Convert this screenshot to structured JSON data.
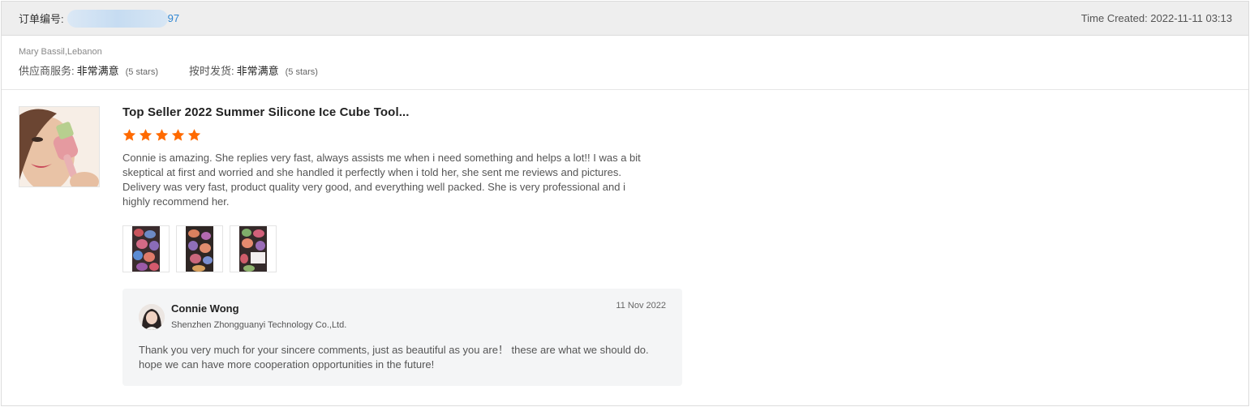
{
  "order": {
    "label": "订单编号:",
    "number_tail": "97"
  },
  "time_created": "Time Created: 2022-11-11 03:13",
  "buyer": {
    "name_location": "Mary Bassil,Lebanon",
    "ratings": [
      {
        "label": "供应商服务:",
        "value": "非常满意",
        "stars": "(5 stars)"
      },
      {
        "label": "按时发货:",
        "value": "非常满意",
        "stars": "(5 stars)"
      }
    ]
  },
  "product": {
    "title": "Top Seller 2022 Summer Silicone Ice Cube Tool...",
    "rating": 5,
    "star_color": "#ff6a00",
    "review": "Connie is amazing. She replies very fast, always assists me when i need something and helps a lot!! I was a bit skeptical at first and worried and she handled it perfectly when i told her, she sent me reviews and pictures. Delivery was very fast, product quality very good, and everything well packed. She is very professional and i highly recommend her.",
    "photo_count": 3
  },
  "reply": {
    "name": "Connie Wong",
    "company": "Shenzhen Zhongguanyi Technology Co.,Ltd.",
    "date": "11 Nov 2022",
    "text": "Thank you very much for your sincere comments, just as beautiful as you are！  these are what we should do. hope we can have more cooperation opportunities in the future!"
  },
  "colors": {
    "link": "#2f86d3",
    "header_bg": "#eeeeee",
    "reply_bg": "#f4f5f6"
  }
}
